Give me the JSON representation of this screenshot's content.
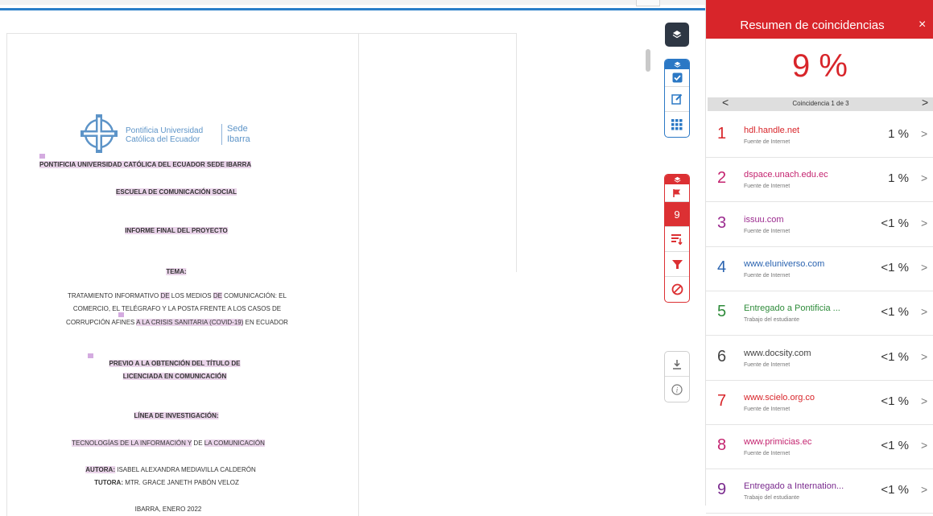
{
  "document": {
    "logo": {
      "university_line1": "Pontificia Universidad",
      "university_line2": "Católica del Ecuador",
      "sede_line1": "Sede",
      "sede_line2": "Ibarra"
    },
    "lines": {
      "l1": "PONTIFICIA UNIVERSIDAD CATÓLICA DEL ECUADOR SEDE IBARRA",
      "l2": "ESCUELA DE COMUNICACIÓN SOCIAL",
      "l3": "INFORME FINAL DEL PROYECTO",
      "l4": "TEMA:",
      "l5a": "TRATAMIENTO INFORMATIVO ",
      "l5b": "DE",
      "l5c": " LOS MEDIOS ",
      "l5d": "DE",
      "l5e": " COMUNICACIÓN: EL",
      "l6": "COMERCIO, EL TELÉGRAFO Y LA POSTA FRENTE A LOS CASOS DE",
      "l7a": "CORRUPCIÓN AFINES ",
      "l7b": "A LA CRISIS SANITARIA (COVID-19)",
      "l7c": " EN ECUADOR",
      "l8": "PREVIO A LA OBTENCIÓN DEL TÍTULO DE",
      "l9": "LICENCIADA EN COMUNICACIÓN",
      "l10": "LÍNEA DE INVESTIGACIÓN:",
      "l11a": "TECNOLOGÍAS DE LA INFORMACIÓN Y",
      "l11b": " DE ",
      "l11c": "LA COMUNICACIÓN",
      "l12a": "AUTORA:",
      "l12b": " ISABEL ALEXANDRA MEDIAVILLA CALDERÓN",
      "l13a": "TUTORA:",
      "l13b": " MTR. GRACE JANETH PABÓN VELOZ",
      "l14": "IBARRA, ENERO 2022"
    }
  },
  "toolbar": {
    "match_count": "9",
    "icons": [
      "layers-icon",
      "checkbox-icon",
      "edit-icon",
      "grid-icon",
      "flag-icon",
      "sort-icon",
      "filter-icon",
      "block-icon",
      "download-icon",
      "info-icon"
    ]
  },
  "panel": {
    "title": "Resumen de coincidencias",
    "close": "×",
    "percentage": "9 %",
    "nav_label": "Coincidencia 1 de 3",
    "prev": "<",
    "next": ">",
    "matches": [
      {
        "num": "1",
        "source": "hdl.handle.net",
        "type": "Fuente de Internet",
        "value": "1 %",
        "color": "#d8252a"
      },
      {
        "num": "2",
        "source": "dspace.unach.edu.ec",
        "type": "Fuente de Internet",
        "value": "1 %",
        "color": "#c4236f"
      },
      {
        "num": "3",
        "source": "issuu.com",
        "type": "Fuente de Internet",
        "value": "<1 %",
        "color": "#9b2a8e"
      },
      {
        "num": "4",
        "source": "www.eluniverso.com",
        "type": "Fuente de Internet",
        "value": "<1 %",
        "color": "#2a63b0"
      },
      {
        "num": "5",
        "source": "Entregado a Pontificia ...",
        "type": "Trabajo del estudiante",
        "value": "<1 %",
        "color": "#2e8b3a"
      },
      {
        "num": "6",
        "source": "www.docsity.com",
        "type": "Fuente de Internet",
        "value": "<1 %",
        "color": "#444444"
      },
      {
        "num": "7",
        "source": "www.scielo.org.co",
        "type": "Fuente de Internet",
        "value": "<1 %",
        "color": "#d8252a"
      },
      {
        "num": "8",
        "source": "www.primicias.ec",
        "type": "Fuente de Internet",
        "value": "<1 %",
        "color": "#c4236f"
      },
      {
        "num": "9",
        "source": "Entregado a Internation...",
        "type": "Trabajo del estudiante",
        "value": "<1 %",
        "color": "#7a2a8e"
      }
    ]
  }
}
